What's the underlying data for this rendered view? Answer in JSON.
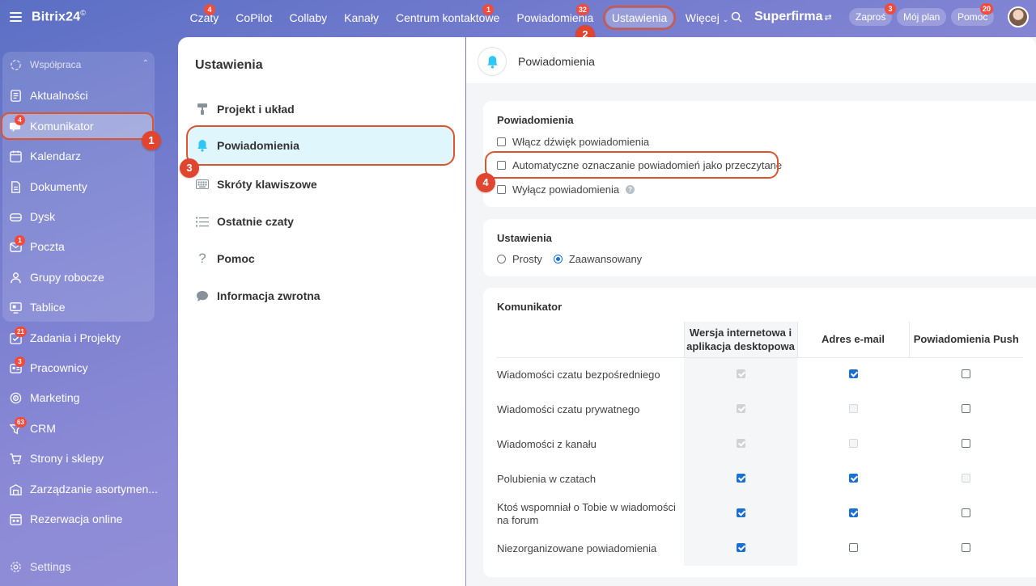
{
  "topbar": {
    "brand": "Bitrix24",
    "brand_mark": "©",
    "nav": [
      {
        "label": "Czaty",
        "badge": "4"
      },
      {
        "label": "CoPilot",
        "badge": ""
      },
      {
        "label": "Collaby",
        "badge": ""
      },
      {
        "label": "Kanały",
        "badge": ""
      },
      {
        "label": "Centrum kontaktowe",
        "badge": "1"
      },
      {
        "label": "Powiadomienia",
        "badge": "32"
      },
      {
        "label": "Ustawienia",
        "badge": ""
      },
      {
        "label": "Więcej",
        "badge": ""
      }
    ],
    "company": "Superfirma",
    "invite": "Zaproś",
    "invite_badge": "3",
    "my_plan": "Mój plan",
    "help": "Pomoc",
    "help_badge": "20"
  },
  "sidebar": {
    "group_title": "Współpraca",
    "items": [
      {
        "label": "Aktualności",
        "badge": ""
      },
      {
        "label": "Komunikator",
        "badge": "4"
      },
      {
        "label": "Kalendarz",
        "badge": ""
      },
      {
        "label": "Dokumenty",
        "badge": ""
      },
      {
        "label": "Dysk",
        "badge": ""
      },
      {
        "label": "Poczta",
        "badge": "1"
      },
      {
        "label": "Grupy robocze",
        "badge": ""
      },
      {
        "label": "Tablice",
        "badge": ""
      },
      {
        "label": "Zadania i Projekty",
        "badge": "21"
      },
      {
        "label": "Pracownicy",
        "badge": "3"
      },
      {
        "label": "Marketing",
        "badge": ""
      },
      {
        "label": "CRM",
        "badge": "63"
      },
      {
        "label": "Strony i sklepy",
        "badge": ""
      },
      {
        "label": "Zarządzanie asortymen...",
        "badge": ""
      },
      {
        "label": "Rezerwacja online",
        "badge": ""
      }
    ],
    "settings": "Settings"
  },
  "steps": [
    "1",
    "2",
    "3",
    "4"
  ],
  "menu": {
    "title": "Ustawienia",
    "items": [
      {
        "label": "Projekt i układ"
      },
      {
        "label": "Powiadomienia"
      },
      {
        "label": "Skróty klawiszowe"
      },
      {
        "label": "Ostatnie czaty"
      },
      {
        "label": "Pomoc"
      },
      {
        "label": "Informacja zwrotna"
      }
    ]
  },
  "content": {
    "header_title": "Powiadomienia",
    "notif_card": {
      "title": "Powiadomienia",
      "options": [
        {
          "label": "Włącz dźwięk powiadomienia",
          "checked": false
        },
        {
          "label": "Automatyczne oznaczanie powiadomień jako przeczytane",
          "checked": false
        },
        {
          "label": "Wyłącz powiadomienia",
          "checked": false
        }
      ]
    },
    "settings_card": {
      "title": "Ustawienia",
      "options": [
        {
          "label": "Prosty",
          "selected": false
        },
        {
          "label": "Zaawansowany",
          "selected": true
        }
      ]
    },
    "messenger_card": {
      "title": "Komunikator",
      "columns": [
        "Wersja internetowa i aplikacja desktopowa",
        "Adres e-mail",
        "Powiadomienia Push"
      ],
      "rows": [
        {
          "label": "Wiadomości czatu bezpośredniego",
          "web": "checked-disabled",
          "email": "checked",
          "push": "unchecked"
        },
        {
          "label": "Wiadomości czatu prywatnego",
          "web": "checked-disabled",
          "email": "disabled",
          "push": "unchecked"
        },
        {
          "label": "Wiadomości z kanału",
          "web": "checked-disabled",
          "email": "disabled",
          "push": "unchecked"
        },
        {
          "label": "Polubienia w czatach",
          "web": "checked",
          "email": "checked",
          "push": "disabled"
        },
        {
          "label": "Ktoś wspomniał o Tobie w wiadomości na forum",
          "web": "checked",
          "email": "checked",
          "push": "unchecked"
        },
        {
          "label": "Niezorganizowane powiadomienia",
          "web": "checked",
          "email": "unchecked",
          "push": "unchecked"
        }
      ]
    }
  },
  "colors": {
    "accent": "#2fc6f6",
    "highlight": "#e0532f",
    "checkbox": "#1a6fd6",
    "badge": "#f04b3c"
  }
}
